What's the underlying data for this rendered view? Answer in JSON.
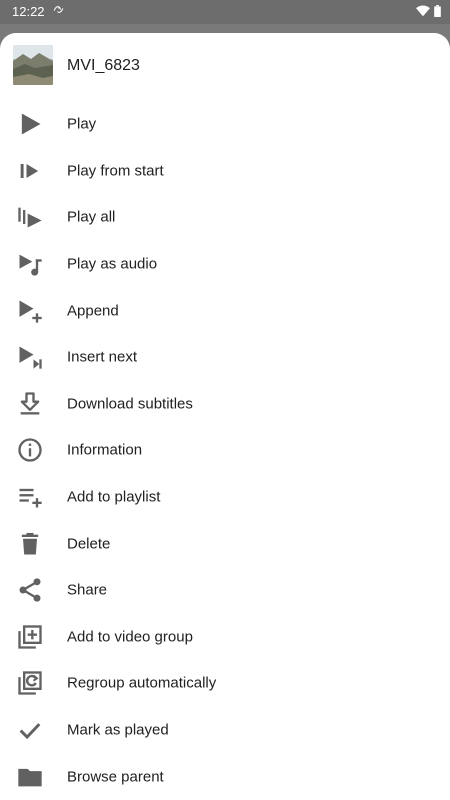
{
  "status_bar": {
    "time": "12:22"
  },
  "header": {
    "title": "MVI_6823"
  },
  "menu": {
    "items": [
      {
        "label": "Play",
        "icon": "play-icon"
      },
      {
        "label": "Play from start",
        "icon": "play-from-start-icon"
      },
      {
        "label": "Play all",
        "icon": "play-all-icon"
      },
      {
        "label": "Play as audio",
        "icon": "play-as-audio-icon"
      },
      {
        "label": "Append",
        "icon": "append-icon"
      },
      {
        "label": "Insert next",
        "icon": "insert-next-icon"
      },
      {
        "label": "Download subtitles",
        "icon": "download-icon"
      },
      {
        "label": "Information",
        "icon": "info-icon"
      },
      {
        "label": "Add to playlist",
        "icon": "playlist-add-icon"
      },
      {
        "label": "Delete",
        "icon": "trash-icon"
      },
      {
        "label": "Share",
        "icon": "share-icon"
      },
      {
        "label": "Add to video group",
        "icon": "add-to-group-icon"
      },
      {
        "label": "Regroup automatically",
        "icon": "regroup-icon"
      },
      {
        "label": "Mark as played",
        "icon": "checkmark-icon"
      },
      {
        "label": "Browse parent",
        "icon": "folder-icon"
      }
    ]
  },
  "colors": {
    "icon": "#616161",
    "text": "#212121",
    "scrim": "#7a7a7a"
  }
}
